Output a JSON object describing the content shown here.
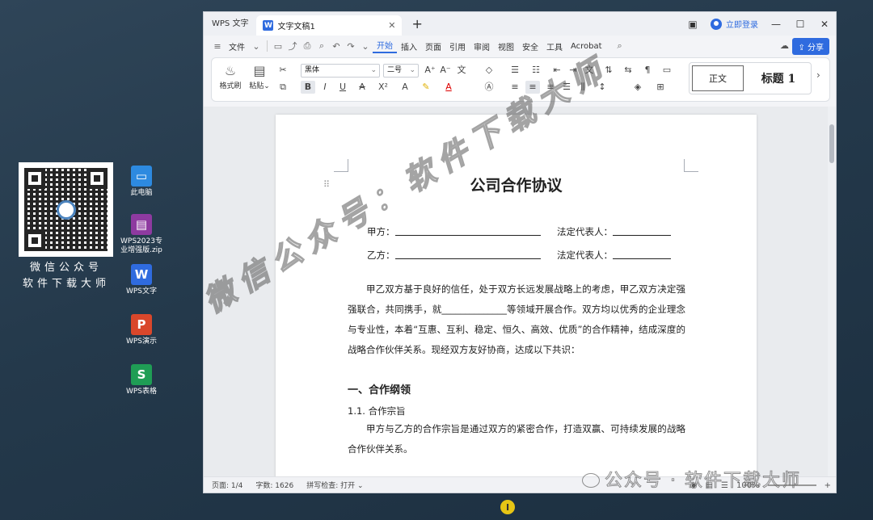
{
  "desktop": {
    "qr_caption_line1": "微信公众号",
    "qr_caption_line2": "软件下载大师",
    "icons": [
      {
        "label": "此电脑",
        "icon": "computer-icon"
      },
      {
        "label": "WPS2023专业增强版.zip",
        "icon": "archive-icon"
      },
      {
        "label": "WPS文字",
        "icon": "wps-writer-icon",
        "glyph": "W",
        "color": "#2f6bdf"
      },
      {
        "label": "WPS演示",
        "icon": "wps-presentation-icon",
        "glyph": "P",
        "color": "#d9472b"
      },
      {
        "label": "WPS表格",
        "icon": "wps-spreadsheet-icon",
        "glyph": "S",
        "color": "#1f9d55"
      }
    ]
  },
  "window": {
    "app_tab": "WPS 文字",
    "doc_tab": "文字文稿1",
    "login": "立即登录",
    "menu": {
      "file": "文件",
      "tabs": [
        "开始",
        "插入",
        "页面",
        "引用",
        "审阅",
        "视图",
        "安全",
        "工具",
        "Acrobat"
      ],
      "active_tab": "开始",
      "share": "分享"
    },
    "ribbon": {
      "format_painter": "格式刷",
      "paste": "粘贴",
      "font_name": "黑体",
      "font_size": "二号",
      "style_normal": "正文",
      "style_heading": "标题 1"
    }
  },
  "document": {
    "title": "公司合作协议",
    "party_a": "甲方：",
    "party_b": "乙方：",
    "legal_rep": "法定代表人：",
    "intro": "甲乙双方基于良好的信任，处于双方长远发展战略上的考虑，甲乙双方决定强强联合，共同携手，就______________等领域开展合作。双方均以优秀的企业理念与专业性，本着“互惠、互利、稳定、恒久、高效、优质”的合作精神，结成深度的战略合作伙伴关系。现经双方友好协商，达成以下共识：",
    "section1": "一、合作纲领",
    "section1_1": "1.1. 合作宗旨",
    "section1_1_text": "甲方与乙方的合作宗旨是通过双方的紧密合作，打造双赢、可持续发展的战略合作伙伴关系。"
  },
  "status": {
    "page": "页面: 1/4",
    "words": "字数: 1626",
    "spell": "拼写检查: 打开",
    "zoom": "100%"
  },
  "watermark": {
    "diagonal": "微信公众号：软件下载大师",
    "bottom": "公众号 · 软件下载大师"
  }
}
